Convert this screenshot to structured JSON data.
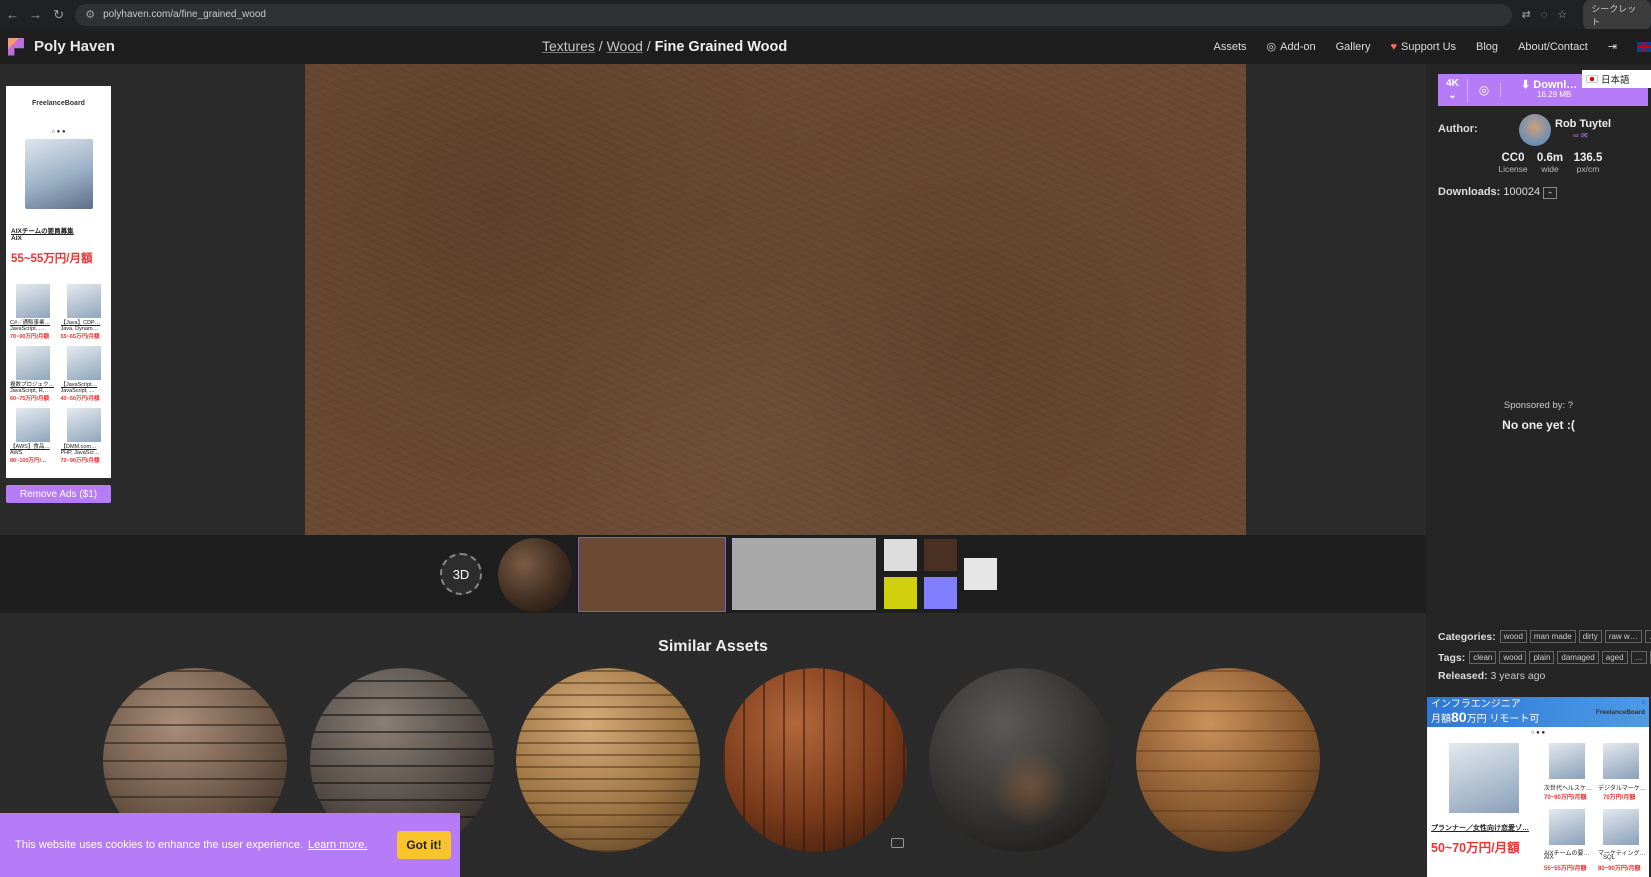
{
  "browser": {
    "url": "polyhaven.com/a/fine_grained_wood",
    "mode_label": "シークレット"
  },
  "header": {
    "site_name": "Poly Haven",
    "breadcrumb": {
      "level1": "Textures",
      "sep1": " / ",
      "level2": "Wood",
      "sep2": " / ",
      "current": "Fine Grained Wood"
    },
    "nav": {
      "assets": "Assets",
      "addon": "Add-on",
      "gallery": "Gallery",
      "support": "Support Us",
      "blog": "Blog",
      "about": "About/Contact"
    }
  },
  "left_ad": {
    "brand": "FreelanceBoard",
    "job_title": "AIXチームの要員募集",
    "job_company": "AIX",
    "salary": "55~55万円/月額",
    "items": [
      {
        "title": "C#／通販事業…",
        "skills": "JavaScript, …",
        "pay": "70~90万円/月額"
      },
      {
        "title": "【Java】CDP…",
        "skills": "Java, Dynam…",
        "pay": "55~65万円/月額"
      },
      {
        "title": "複数プロジェク…",
        "skills": "JavaScript, R…",
        "pay": "60~75万円/月額"
      },
      {
        "title": "【JavaScript…",
        "skills": "JavaScript, …",
        "pay": "40~50万円/月額"
      },
      {
        "title": "【AWS】食品…",
        "skills": "AWS",
        "pay": "80~100万円/…"
      },
      {
        "title": "【DMM.com…",
        "skills": "PHP, JavaScr…",
        "pay": "70~90万円/月額"
      }
    ],
    "remove_ads": "Remove Ads ($1)"
  },
  "viewer": {
    "btn_3d": "3D"
  },
  "similar": {
    "title": "Similar Assets"
  },
  "cookie": {
    "message": "This website uses cookies to enhance the user experience.",
    "learn_more": "Learn more.",
    "accept": "Got it!"
  },
  "sidebar": {
    "resolution": "4K",
    "download_label": "Downl…",
    "download_size": "16.29 MB",
    "language": "日本語",
    "author_label": "Author:",
    "author_name": "Rob Tuytel",
    "stats": [
      {
        "value": "CC0",
        "label": "License"
      },
      {
        "value": "0.6m",
        "label": "wide"
      },
      {
        "value": "136.5",
        "label": "px/cm"
      }
    ],
    "downloads_label": "Downloads:",
    "downloads_value": "100024",
    "sponsored_label": "Sponsored by:",
    "sponsored_value": "No one yet :(",
    "categories_label": "Categories:",
    "categories": [
      "wood",
      "man made",
      "dirty",
      "raw w…",
      "…"
    ],
    "tags_label": "Tags:",
    "tags": [
      "clean",
      "wood",
      "plain",
      "damaged",
      "aged",
      "…",
      "…"
    ],
    "released_label": "Released:",
    "released_value": "3 years ago"
  },
  "right_ad": {
    "headline": "インフラエンジニア",
    "sub": "月額",
    "amount": "80",
    "unit": "万円 リモート可",
    "brand": "FreelanceBoard",
    "items": [
      {
        "title": "次世代ヘルスケ…",
        "pay": "70~90万円/月額"
      },
      {
        "title": "デジタルマーケ…",
        "pay": "70万円/月額"
      },
      {
        "title": "AIXチームの要…",
        "skills": "AIX",
        "pay": "55~55万円/月額"
      },
      {
        "title": "マーケティング…",
        "skills": "SQL",
        "pay": "80~90万円/月額"
      }
    ],
    "job_title": "プランナー／女性向け恋愛ゾ…",
    "salary": "50~70万円/月額"
  }
}
